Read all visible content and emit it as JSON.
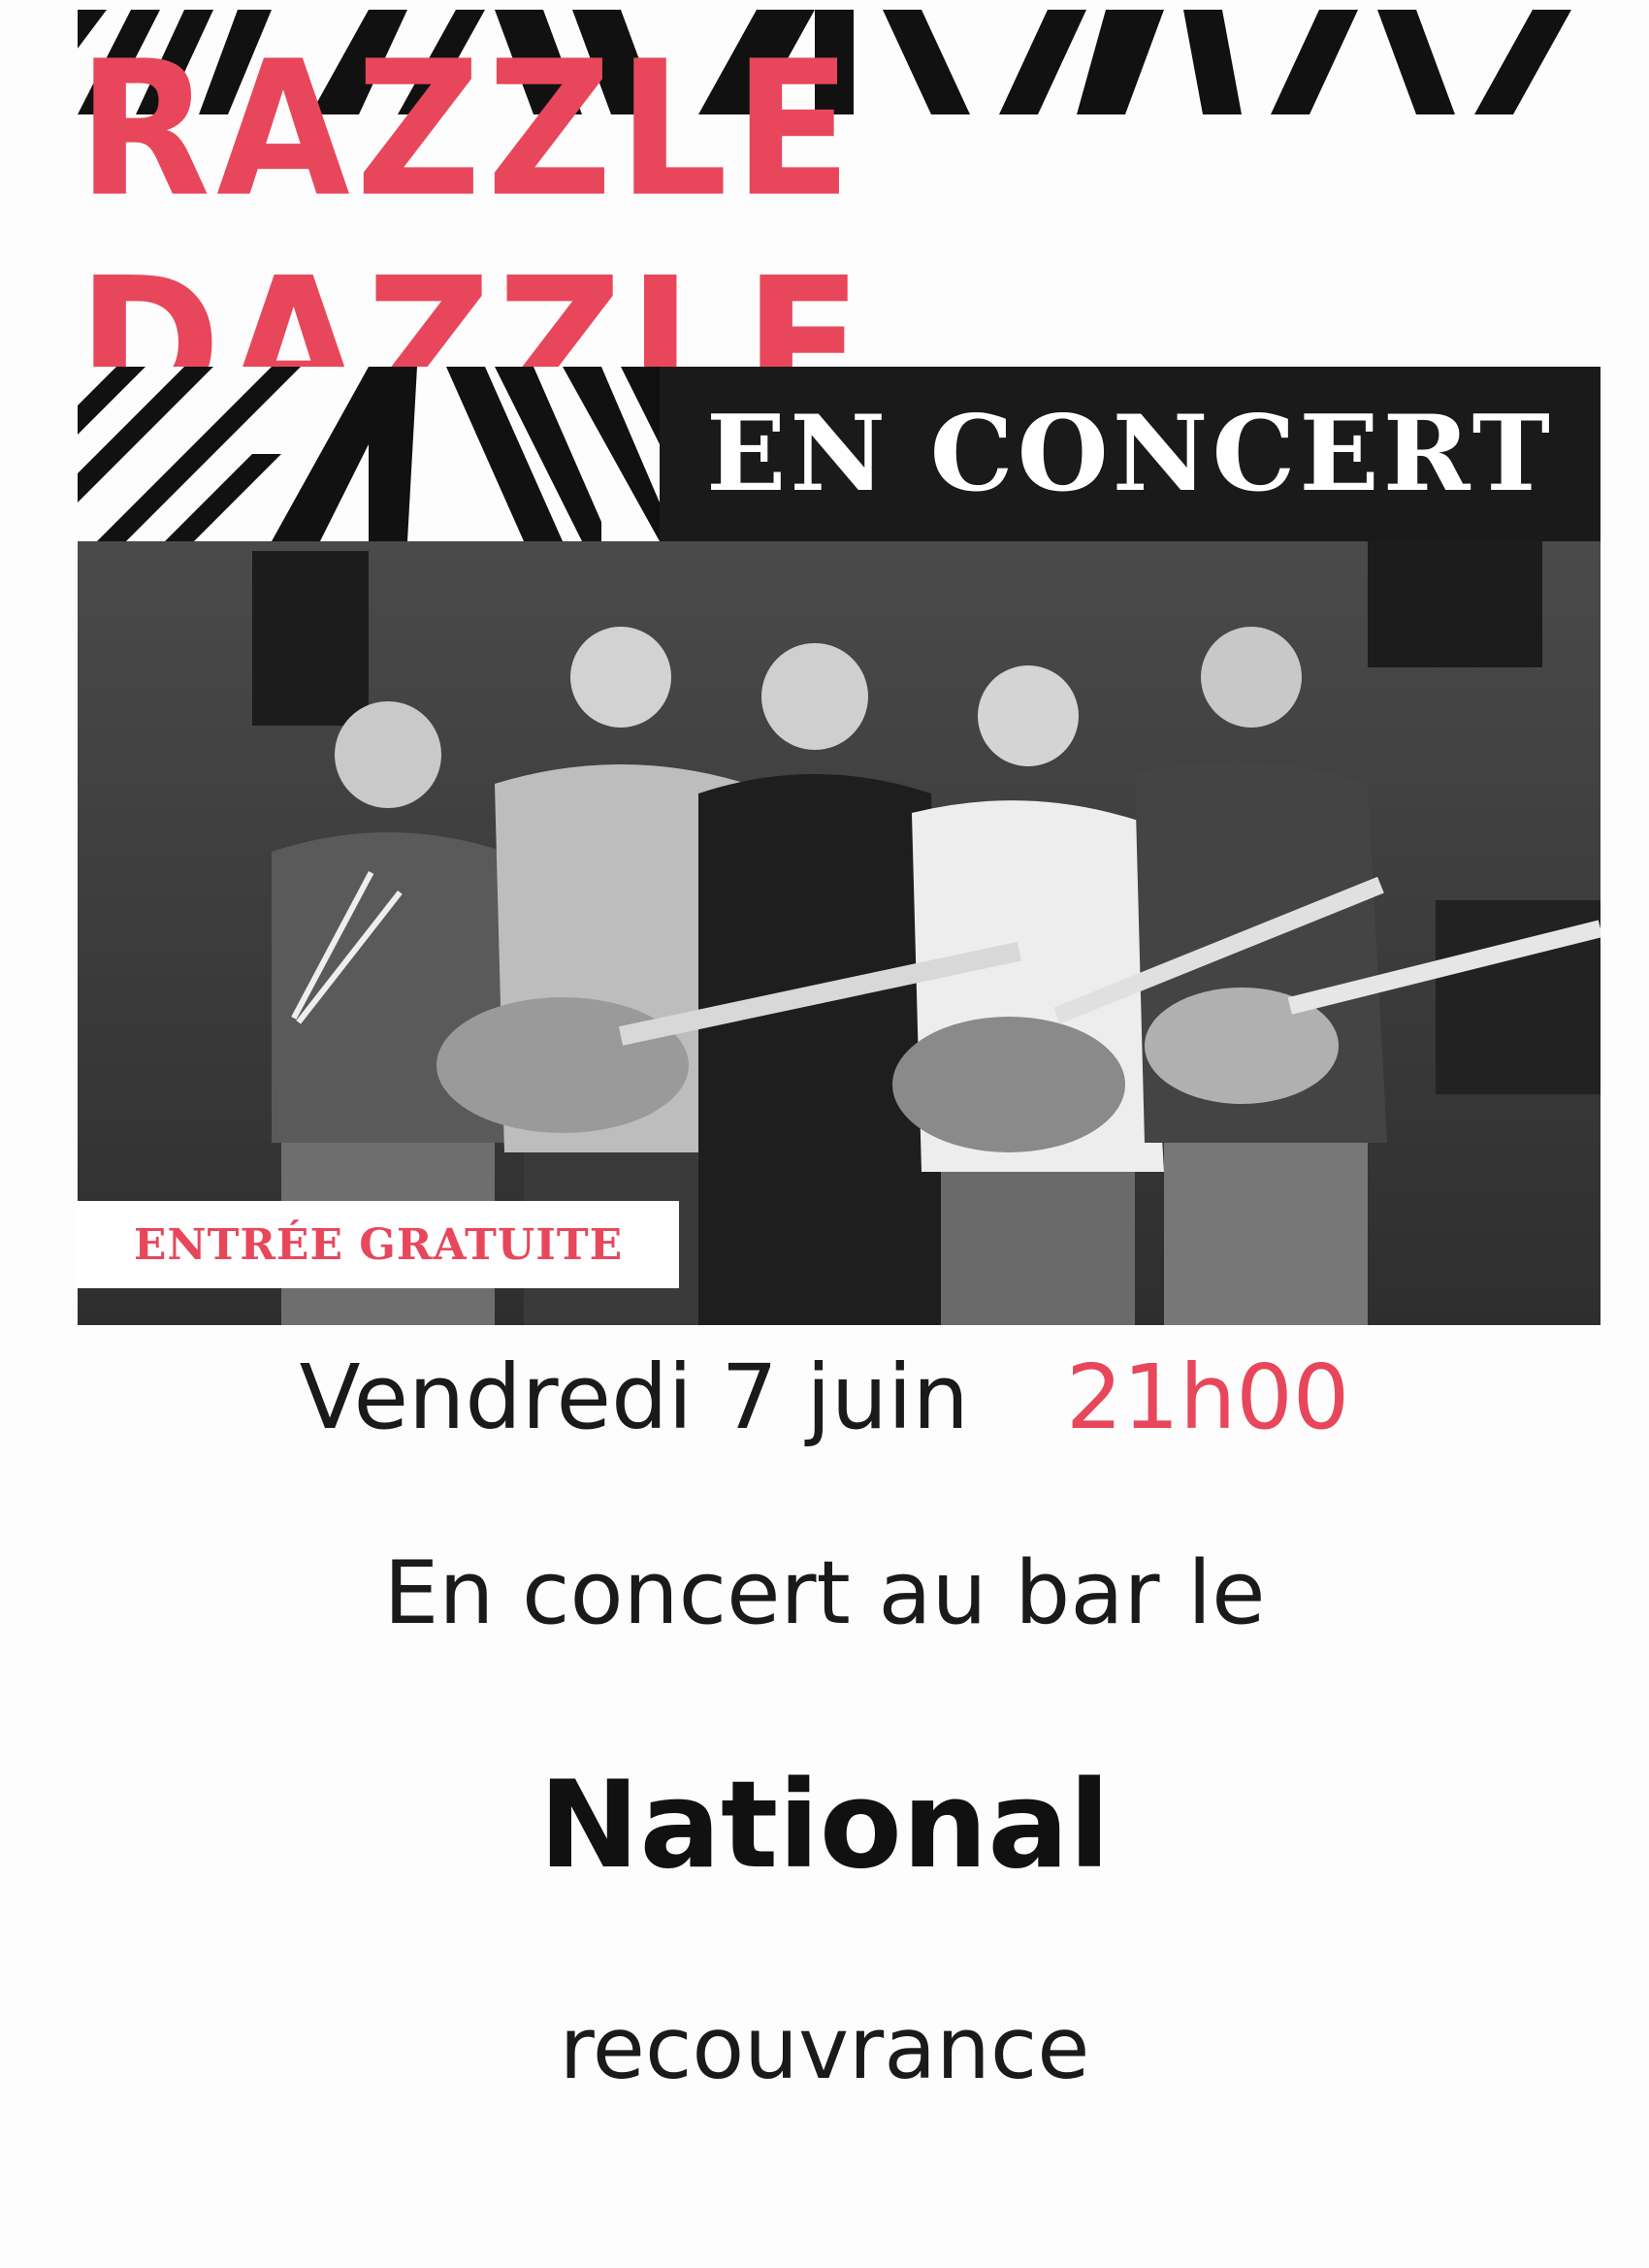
{
  "poster": {
    "band_name": "RAZZLE DAZZLE",
    "subtitle": "EN CONCERT",
    "badge": "ENTRÉE GRATUITE",
    "date": "Vendredi 7 juin",
    "time": "21h00",
    "venue_intro": "En concert au bar le",
    "venue_name": "National",
    "location": "recouvrance"
  },
  "colors": {
    "accent": "#e8475b",
    "dark": "#1a1a1a",
    "background": "#fdfdfd"
  },
  "photo": {
    "description_icon": "band-photo",
    "members_count": 5
  }
}
